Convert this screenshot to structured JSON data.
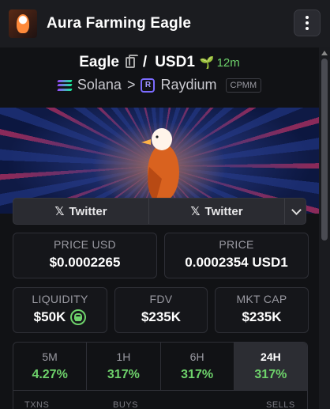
{
  "header": {
    "title": "Aura Farming Eagle"
  },
  "pair": {
    "base": "Eagle",
    "quote": "USD1",
    "separator": "/",
    "age": "12m"
  },
  "chain": {
    "network": "Solana",
    "arrow": ">",
    "dex": "Raydium",
    "badge": "CPMM"
  },
  "social": {
    "links": [
      {
        "label": "Twitter"
      },
      {
        "label": "Twitter"
      }
    ]
  },
  "stats": {
    "price_usd": {
      "label": "PRICE USD",
      "value": "$0.0002265"
    },
    "price": {
      "label": "PRICE",
      "value": "0.0002354 USD1"
    },
    "liquidity": {
      "label": "LIQUIDITY",
      "value": "$50K"
    },
    "fdv": {
      "label": "FDV",
      "value": "$235K"
    },
    "mkt_cap": {
      "label": "MKT CAP",
      "value": "$235K"
    }
  },
  "timeframes": [
    {
      "name": "5M",
      "change": "4.27%"
    },
    {
      "name": "1H",
      "change": "317%"
    },
    {
      "name": "6H",
      "change": "317%"
    },
    {
      "name": "24H",
      "change": "317%",
      "active": true
    }
  ],
  "bottom_labels": {
    "txns": "TXNS",
    "buys": "BUYS",
    "sells": "SELLS"
  },
  "colors": {
    "positive": "#6ed26b",
    "background": "#111215",
    "panel": "#1b1c20"
  }
}
